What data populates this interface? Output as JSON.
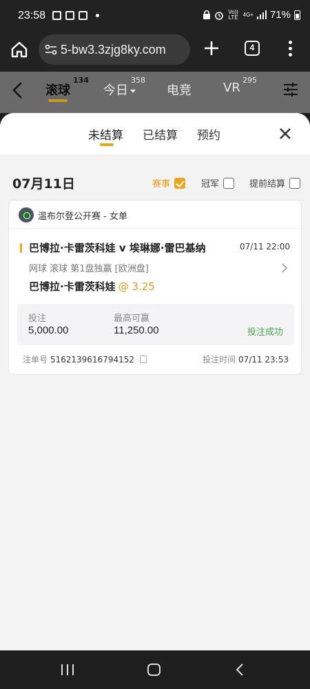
{
  "status_bar": {
    "time": "23:58",
    "network_top": "Vo)) LTE",
    "network_4g": "4G+",
    "battery": "71%"
  },
  "browser": {
    "url": "5-bw3.3zjg8ky.com",
    "tab_count": "4"
  },
  "sports_nav": {
    "tabs": [
      {
        "label": "滚球",
        "count": "134",
        "active": true
      },
      {
        "label": "今日",
        "count": "358",
        "active": false
      },
      {
        "label": "电竞",
        "count": "",
        "active": false
      },
      {
        "label": "VR",
        "count": "295",
        "active": false
      }
    ]
  },
  "sheet": {
    "tabs": [
      {
        "label": "未结算",
        "active": true
      },
      {
        "label": "已结算",
        "active": false
      },
      {
        "label": "预约",
        "active": false
      }
    ],
    "date": "07月11日",
    "filters": [
      {
        "label": "赛事",
        "checked": true
      },
      {
        "label": "冠军",
        "checked": false
      },
      {
        "label": "提前结算",
        "checked": false
      }
    ]
  },
  "bet": {
    "league": "温布尔登公开赛 - 女单",
    "match": "巴博拉·卡雷茨科娃 v 埃琳娜·雷巴基纳",
    "match_time": "07/11 22:00",
    "market": "网球  滚球   第1盘独赢 [欧洲盘]",
    "selection": "巴博拉·卡雷茨科娃",
    "odds": "@ 3.25",
    "stake_label": "投注",
    "stake_value": "5,000.00",
    "max_win_label": "最高可赢",
    "max_win_value": "11,250.00",
    "status": "投注成功",
    "order_label": "注单号",
    "order_no": "5162139616794152",
    "bet_time_label": "投注时间",
    "bet_time": "07/11 23:53"
  },
  "colors": {
    "accent": "#e8a71c",
    "success": "#4ba44a",
    "nav_bg": "#6a6a6a"
  }
}
